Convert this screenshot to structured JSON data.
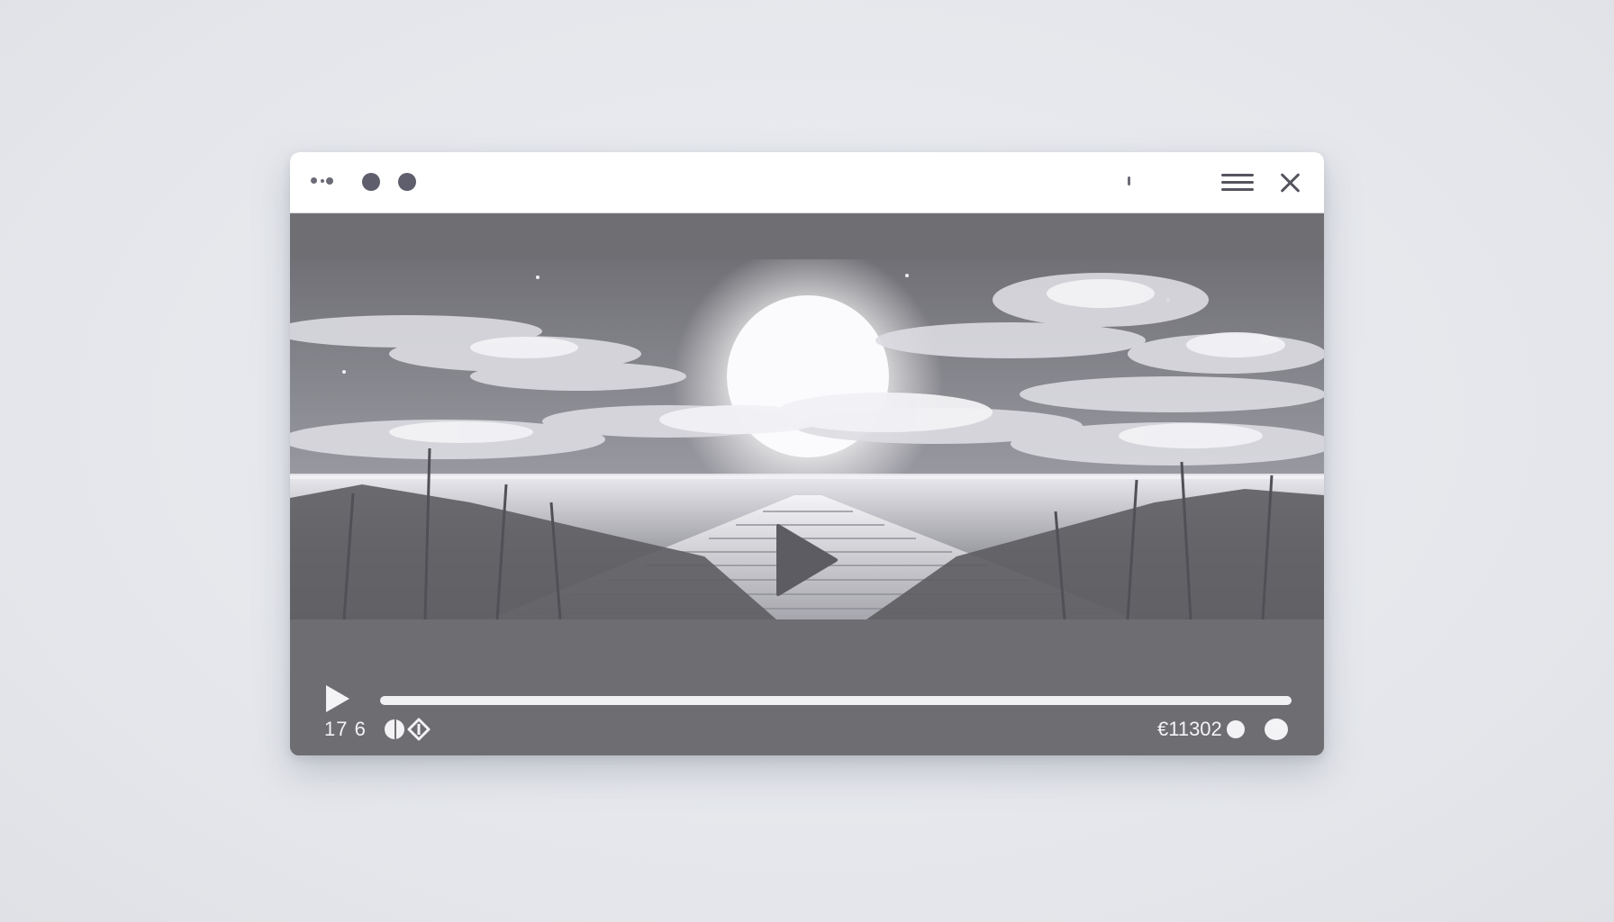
{
  "titlebar": {
    "menu_icon": "hamburger-menu-icon",
    "close_icon": "close-icon"
  },
  "player": {
    "center_play_icon": "play-icon",
    "progress_fraction": 1.0,
    "time_left": "17 6",
    "time_right": "€11302"
  },
  "colors": {
    "background": "#e7e8ed",
    "player_frame": "#6e6e72",
    "titlebar": "#ffffff",
    "control_fg": "#f3f3f6"
  }
}
